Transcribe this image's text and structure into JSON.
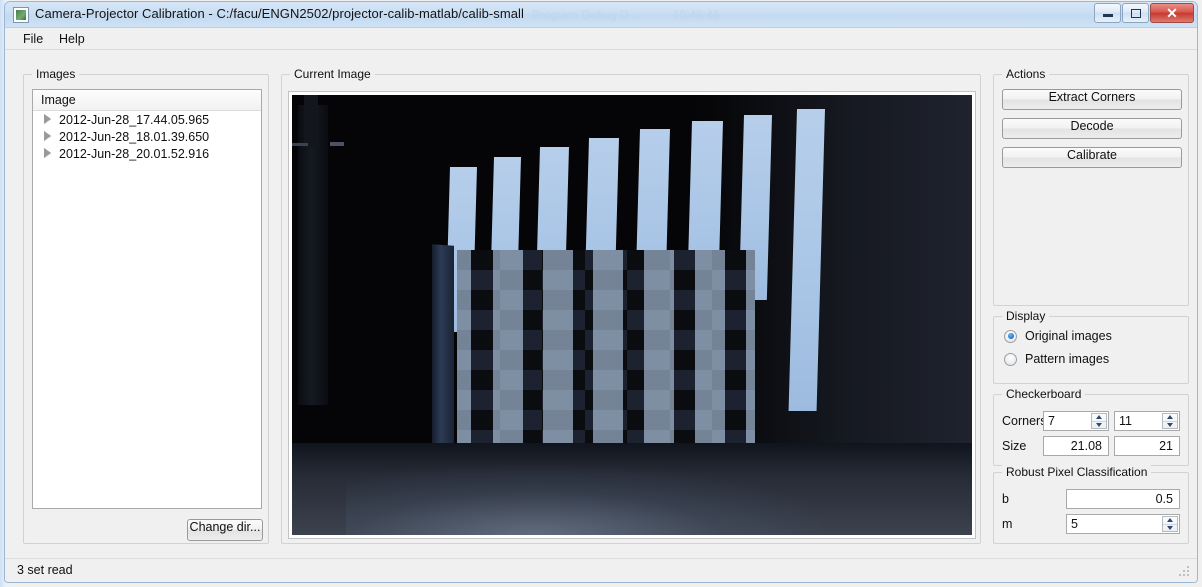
{
  "window": {
    "title": "Camera-Projector Calibration - C:/facu/ENGN2502/projector-calib-matlab/calib-small",
    "icon": "app-icon",
    "ghost_title_1": "Program Debug D...",
    "ghost_title_2": "10:48:46",
    "controls": {
      "minimize": "minimize-icon",
      "restore": "restore-icon",
      "close": "✕"
    }
  },
  "menubar": {
    "items": [
      {
        "label": "File"
      },
      {
        "label": "Help"
      }
    ]
  },
  "images_panel": {
    "group_title": "Images",
    "column_header": "Image",
    "rows": [
      {
        "label": "2012-Jun-28_17.44.05.965",
        "expander": "chevron-right-icon"
      },
      {
        "label": "2012-Jun-28_18.01.39.650",
        "expander": "chevron-right-icon"
      },
      {
        "label": "2012-Jun-28_20.01.52.916",
        "expander": "chevron-right-icon"
      }
    ],
    "change_dir_label": "Change dir..."
  },
  "current_image_panel": {
    "group_title": "Current Image",
    "description": "Structured-light scan photo: dark room with a checkerboard calibration target illuminated by vertical projected light stripes"
  },
  "actions": {
    "group_title": "Actions",
    "buttons": [
      {
        "label": "Extract Corners"
      },
      {
        "label": "Decode"
      },
      {
        "label": "Calibrate"
      }
    ]
  },
  "display": {
    "group_title": "Display",
    "options": [
      {
        "label": "Original images",
        "selected": true
      },
      {
        "label": "Pattern images",
        "selected": false
      }
    ]
  },
  "checkerboard": {
    "group_title": "Checkerboard",
    "corners_label": "Corners",
    "corners_x": "7",
    "corners_y": "11",
    "size_label": "Size",
    "size_x": "21.08",
    "size_y": "21"
  },
  "robust_pixel_classification": {
    "group_title": "Robust Pixel Classification",
    "b_label": "b",
    "b_value": "0.5",
    "m_label": "m",
    "m_value": "5"
  },
  "statusbar": {
    "text": "3 set read"
  },
  "colors": {
    "titlebar": "#c9ddf2",
    "close_button": "#d9554b",
    "window_background": "#f0f0f0",
    "radio_accent": "#1d72c4",
    "photo_background": "#050507",
    "stripe_light": "#b6ceea"
  }
}
